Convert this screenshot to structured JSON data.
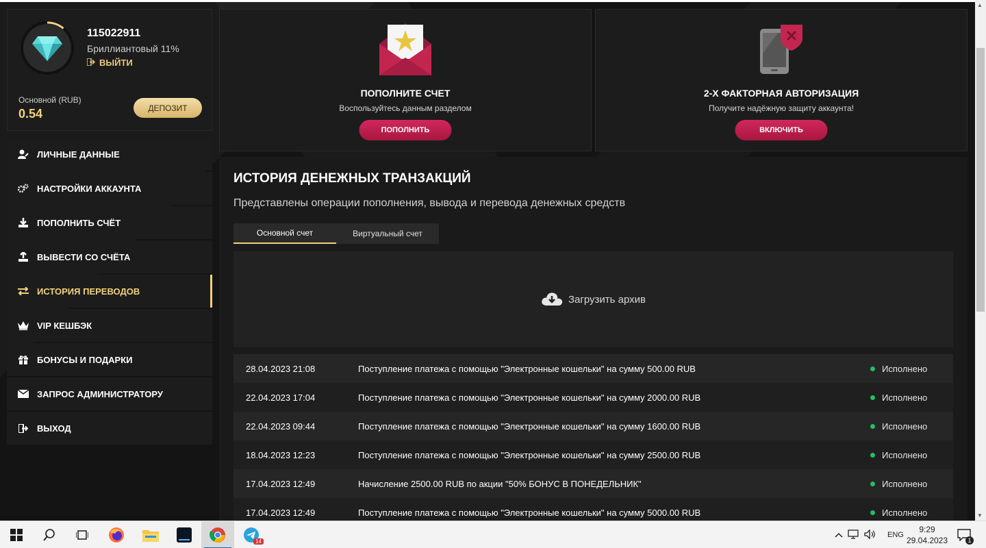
{
  "profile": {
    "user_id": "115022911",
    "level": "Бриллиантовый 11%",
    "logout": "ВЫЙТИ",
    "balance_label": "Основной (RUB)",
    "balance_value": "0.54",
    "deposit_button": "ДЕПОЗИТ",
    "level_progress": 0.11
  },
  "menu": {
    "items": [
      {
        "label": "ЛИЧНЫЕ ДАННЫЕ",
        "icon": "user-edit-icon"
      },
      {
        "label": "НАСТРОЙКИ АККАУНТА",
        "icon": "gears-icon"
      },
      {
        "label": "ПОПОЛНИТЬ СЧЁТ",
        "icon": "download-icon"
      },
      {
        "label": "ВЫВЕСТИ СО СЧЁТА",
        "icon": "upload-icon"
      },
      {
        "label": "ИСТОРИЯ ПЕРЕВОДОВ",
        "icon": "transfer-arrows-icon"
      },
      {
        "label": "VIP КЕШБЭК",
        "icon": "crown-icon"
      },
      {
        "label": "БОНУСЫ И ПОДАРКИ",
        "icon": "gift-icon"
      },
      {
        "label": "ЗАПРОС АДМИНИСТРАТОРУ",
        "icon": "envelope-icon"
      },
      {
        "label": "ВЫХОД",
        "icon": "sign-out-icon"
      }
    ]
  },
  "cards": {
    "deposit": {
      "title": "ПОПОЛНИТЕ СЧЕТ",
      "subtitle": "Воспользуйтесь данным разделом",
      "button": "ПОПОЛНИТЬ"
    },
    "twofa": {
      "title": "2-Х ФАКТОРНАЯ АВТОРИЗАЦИЯ",
      "subtitle": "Получите надёжную защиту аккаунта!",
      "button": "ВКЛЮЧИТЬ"
    }
  },
  "history": {
    "title": "ИСТОРИЯ ДЕНЕЖНЫХ ТРАНЗАКЦИЙ",
    "subtitle": "Представлены операции пополнения, вывода и перевода денежных средств",
    "tabs": [
      "Основной счет",
      "Виртуальный счет"
    ],
    "archive": "Загрузить архив",
    "rows": [
      {
        "date": "28.04.2023 21:08",
        "desc": "Поступление платежа с помощью \"Электронные кошельки\" на сумму 500.00 RUB",
        "status": "Исполнено"
      },
      {
        "date": "22.04.2023 17:04",
        "desc": "Поступление платежа с помощью \"Электронные кошельки\" на сумму 2000.00 RUB",
        "status": "Исполнено"
      },
      {
        "date": "22.04.2023 09:44",
        "desc": "Поступление платежа с помощью \"Электронные кошельки\" на сумму 1600.00 RUB",
        "status": "Исполнено"
      },
      {
        "date": "18.04.2023 12:23",
        "desc": "Поступление платежа с помощью \"Электронные кошельки\" на сумму 2500.00 RUB",
        "status": "Исполнено"
      },
      {
        "date": "17.04.2023 12:49",
        "desc": "Начисление 2500.00 RUB по акции \"50% БОНУС В ПОНЕДЕЛЬНИК\"",
        "status": "Исполнено"
      },
      {
        "date": "17.04.2023 12:49",
        "desc": "Поступление платежа с помощью \"Электронные кошельки\" на сумму 5000.00 RUB",
        "status": "Исполнено"
      }
    ]
  },
  "taskbar": {
    "telegram_badge": "14",
    "lang": "ENG",
    "time": "9:29",
    "date": "29.04.2023",
    "notifications": "1"
  },
  "colors": {
    "accent_gold": "#f1d27c",
    "accent_pink": "#c51f50",
    "status_green": "#21c25e"
  }
}
